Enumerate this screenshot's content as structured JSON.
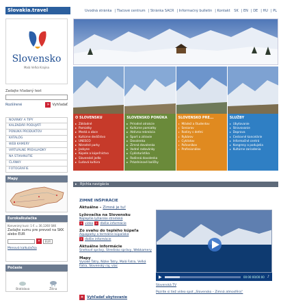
{
  "header": {
    "brand": "Slovakia.travel",
    "links": [
      "Úvodná stránka",
      "Tlačové centrum",
      "Stránka SACR",
      "Informačný bulletin",
      "Kontakt",
      "SK",
      "EN",
      "DE",
      "HU",
      "PL"
    ]
  },
  "logo": {
    "word": "Slovensko",
    "tag": "Malá Veľká Krajina"
  },
  "search": {
    "label": "Zadajte hľadaný text",
    "placeholder": "",
    "advanced": "Rozšírené",
    "button": "Vyhľadať"
  },
  "nav": [
    "NOVINKY A TIPY",
    "KALENDÁR PODUJATÍ",
    "PONUKA PRODUKTOV",
    "KATALÓG",
    "WEB KAMERY",
    "VIRTUÁLNE PREHLIADKY",
    "NA STIAHNUTIE",
    "ČLÁNKY",
    "FOTOGRAFIE"
  ],
  "map": {
    "title": "Mapy"
  },
  "euro": {
    "title": "Eurokalkulačka",
    "rate": "Konverzný kurz: 1 € = 30,1260 SKK",
    "prompt": "Zadajte sumu pre prevod na SKK alebo EUR",
    "button": "EUR",
    "link": "Menová kalkulačka"
  },
  "weather": {
    "title": "Počasie",
    "days": [
      "Bratislava",
      "Žilina"
    ]
  },
  "tiles": [
    {
      "title": "O SLOVENSKU",
      "color": "#c63a2a",
      "items": [
        "Základné",
        "Pamiatky",
        "Mestá a obce",
        "Kultúrne dedičstvo",
        "UNESCO",
        "Národné parky",
        "Jaskyne",
        "Kúpele a kúpeľníctvo",
        "Slovenské jedlo",
        "Ľudová kultúra"
      ]
    },
    {
      "title": "SLOVENSKO PONÚKA",
      "color": "#6a8a3a",
      "items": [
        "Prírodné atrakcie",
        "Kultúrne pamiatky",
        "Aktívna rekreácia",
        "Šport a zdravie",
        "Dovolenka",
        "Zimná dovolenka",
        "Vodné radovánky",
        "Cykloturistika",
        "Rodinná dovolenka",
        "Prázdninové balíčky"
      ]
    },
    {
      "title": "SLOVENSKO PRE...",
      "color": "#e08a20",
      "items": [
        "Mládež a študentov",
        "Seniorov",
        "Rodiny s deťmi",
        "Rybárov",
        "Cyklistov",
        "Poľovníkov",
        "Profesionálov"
      ]
    },
    {
      "title": "SLUŽBY",
      "color": "#2f7fc4",
      "items": [
        "Ubytovanie",
        "Stravovanie",
        "Doprava",
        "Cestovné kancelárie",
        "Informačné centrá",
        "Kongresy a podujatia",
        "Kultúrne zariadenia"
      ]
    }
  ],
  "subnav": "Rýchla navigácia",
  "content": {
    "heading": "ZIMNÉ INŠPIRÁCIE",
    "items": [
      {
        "title": "Aktuálne",
        "link": "Zimné je tu!",
        "subs": []
      },
      {
        "title": "Lyžovačka na Slovensku",
        "subs": [
          "Najlepšie lyžiarske strediská"
        ],
        "icons": [
          "video",
          "ďalšie informácie"
        ]
      },
      {
        "title": "Zo svahu do teplého kúpeľa",
        "subs": [
          "Aquaparky a termálne kúpaliská"
        ],
        "icons": [
          "ďalšie informácie"
        ]
      },
      {
        "title": "Aktuálne informácie",
        "subs": [
          "Snehové správy",
          "Stredisko správy",
          "Webkamery"
        ]
      },
      {
        "title": "Mapy",
        "subs": [
          "Vysoké Tatry",
          "Nízke Tatry",
          "Malá Fatra",
          "Veľká Fatra",
          "Slovenský raj",
          "viac"
        ]
      }
    ],
    "bottom": "Vyhľadať ubytovanie",
    "video_time": "00:00:00/00:00",
    "vid_links": [
      "Slovenská TV",
      "Pozrite si tiež video spot „Slovensko – Zimná atmosféra“"
    ]
  }
}
